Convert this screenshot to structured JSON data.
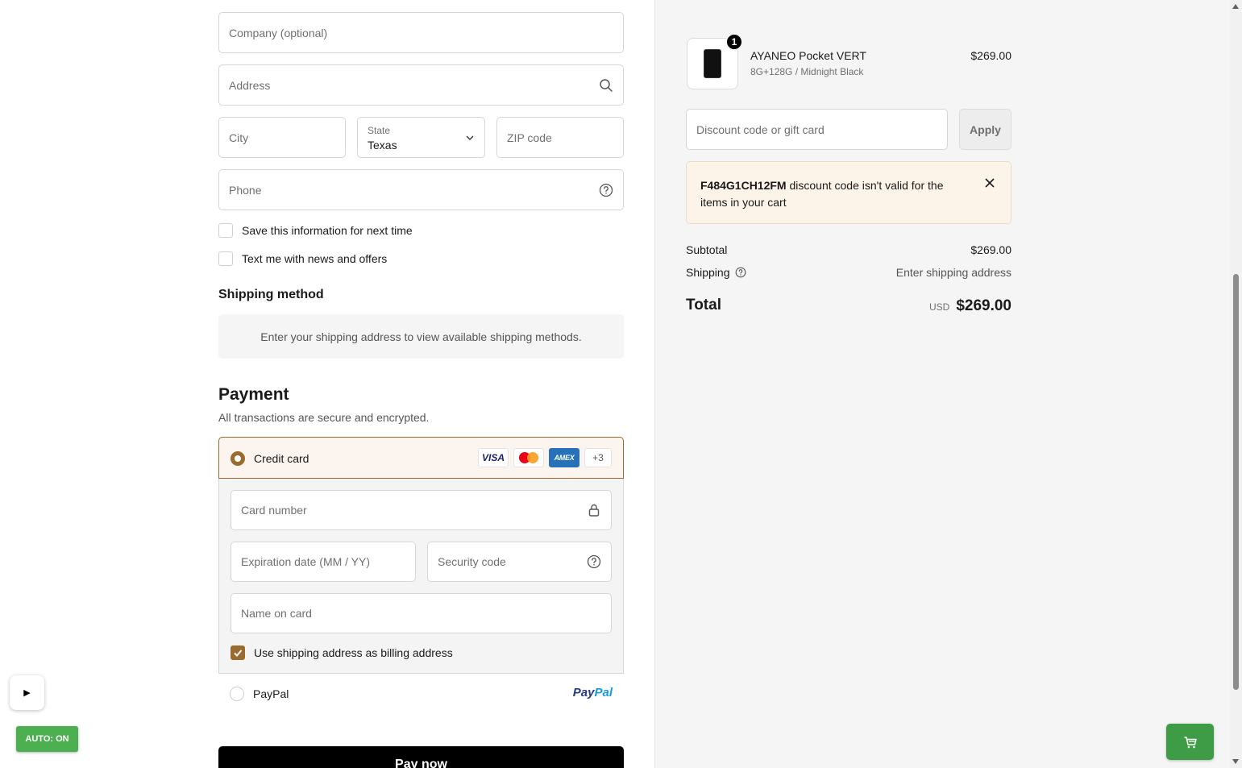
{
  "form": {
    "company_placeholder": "Company (optional)",
    "address_placeholder": "Address",
    "city_placeholder": "City",
    "state_label": "State",
    "state_value": "Texas",
    "zip_placeholder": "ZIP code",
    "phone_placeholder": "Phone",
    "save_info_label": "Save this information for next time",
    "news_label": "Text me with news and offers"
  },
  "shipping": {
    "heading": "Shipping method",
    "message": "Enter your shipping address to view available shipping methods."
  },
  "payment": {
    "heading": "Payment",
    "subtitle": "All transactions are secure and encrypted.",
    "credit_card_label": "Credit card",
    "badges": {
      "visa": "VISA",
      "amex": "AMEX",
      "more": "+3"
    },
    "card_number_placeholder": "Card number",
    "expiration_placeholder": "Expiration date (MM / YY)",
    "security_code_placeholder": "Security code",
    "name_on_card_placeholder": "Name on card",
    "billing_same_label": "Use shipping address as billing address",
    "paypal_label": "PayPal",
    "paypal_logo_1": "Pay",
    "paypal_logo_2": "Pal",
    "pay_now_label": "Pay now"
  },
  "widgets": {
    "play_glyph": "▶",
    "auto_label": "AUTO: ON"
  },
  "order": {
    "quantity": "1",
    "product_name": "AYANEO Pocket VERT",
    "product_variant": "8G+128G / Midnight Black",
    "product_price": "$269.00",
    "discount_placeholder": "Discount code or gift card",
    "apply_label": "Apply",
    "alert_code": "F484G1CH12FM",
    "alert_message": " discount code isn't valid for the items in your cart",
    "subtotal_label": "Subtotal",
    "subtotal_value": "$269.00",
    "shipping_label": "Shipping",
    "shipping_value": "Enter shipping address",
    "total_label": "Total",
    "currency": "USD",
    "total_value": "$269.00"
  },
  "colors": {
    "accent": "#9b6a2f",
    "alert_bg": "#fcf4e8",
    "green": "#4caf50"
  }
}
